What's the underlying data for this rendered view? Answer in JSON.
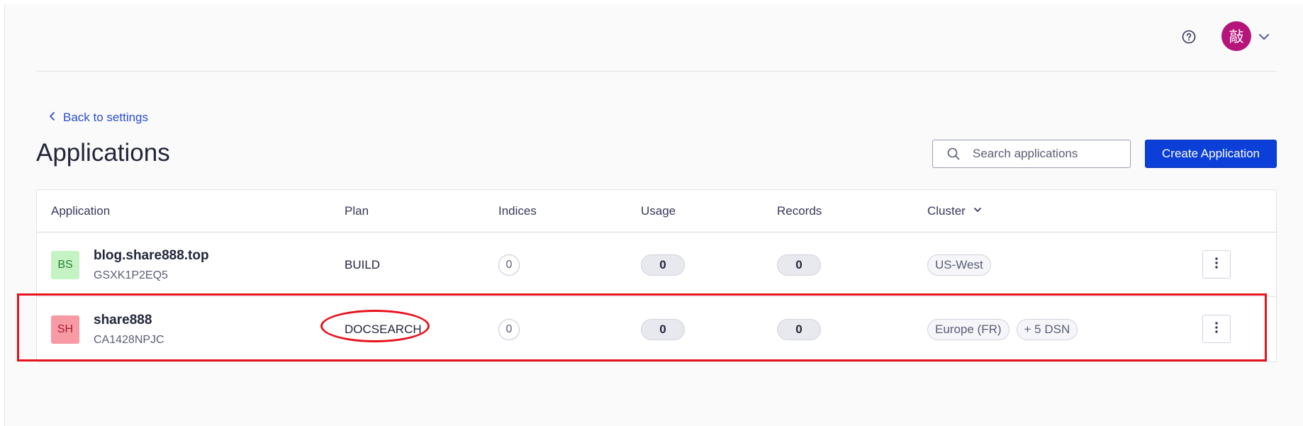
{
  "header": {
    "help_icon": "question-circle-icon",
    "avatar": {
      "initial": "敲",
      "color": "#b5157a"
    },
    "chevron_icon": "chevron-down-icon"
  },
  "nav": {
    "back_label": "Back to settings",
    "back_icon": "chevron-left-icon"
  },
  "page": {
    "title": "Applications"
  },
  "search": {
    "placeholder": "Search applications",
    "value": ""
  },
  "actions": {
    "create_label": "Create Application"
  },
  "table": {
    "headers": {
      "application": "Application",
      "plan": "Plan",
      "indices": "Indices",
      "usage": "Usage",
      "records": "Records",
      "cluster": "Cluster"
    },
    "rows": [
      {
        "initials": "BS",
        "badge_bg": "#c4f4c4",
        "badge_fg": "#2e7d32",
        "name": "blog.share888.top",
        "app_id": "GSXK1P2EQ5",
        "plan": "BUILD",
        "indices": "0",
        "usage": "0",
        "records": "0",
        "clusters": [
          "US-West"
        ]
      },
      {
        "initials": "SH",
        "badge_bg": "#f79aa4",
        "badge_fg": "#a3202e",
        "name": "share888",
        "app_id": "CA1428NPJC",
        "plan": "DOCSEARCH",
        "indices": "0",
        "usage": "0",
        "records": "0",
        "clusters": [
          "Europe (FR)",
          "+ 5 DSN"
        ]
      }
    ]
  },
  "colors": {
    "accent": "#0b3fd8",
    "link": "#2a4ed1",
    "annotation": "#e8121c"
  }
}
